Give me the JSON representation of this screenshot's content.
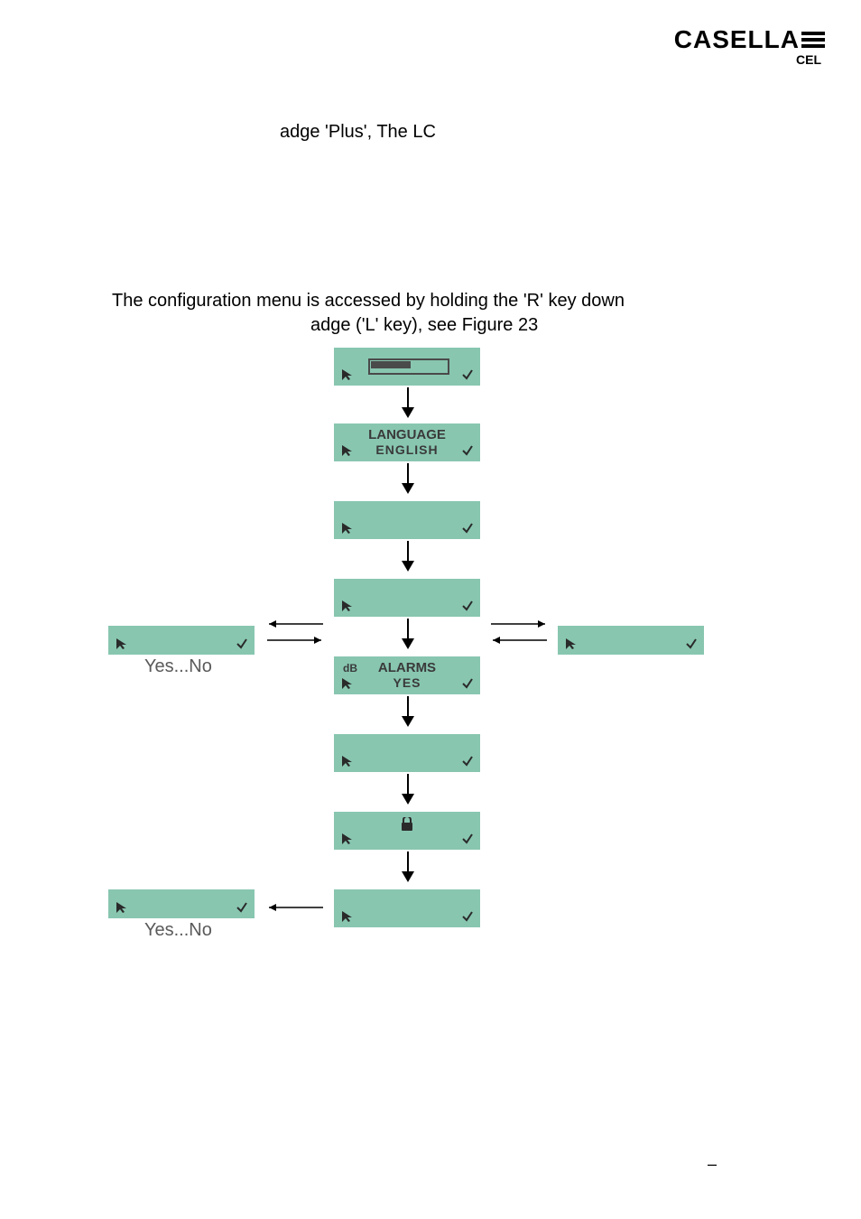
{
  "logo": {
    "brand": "CASELLA",
    "sub": "CEL"
  },
  "fragment1": "adge 'Plus', The LC",
  "para_line1": "The configuration menu is accessed by holding the 'R' key down",
  "para_line2": "adge ('L' key), see Figure 23",
  "boxes": {
    "language_top": "LANGUAGE",
    "language_sub": "ENGLISH",
    "alarms_db": "dB",
    "alarms_top": "ALARMS",
    "alarms_sub": "YES"
  },
  "captions": {
    "yesno1": "Yes...No",
    "yesno2": "Yes...No"
  },
  "foot": "–"
}
